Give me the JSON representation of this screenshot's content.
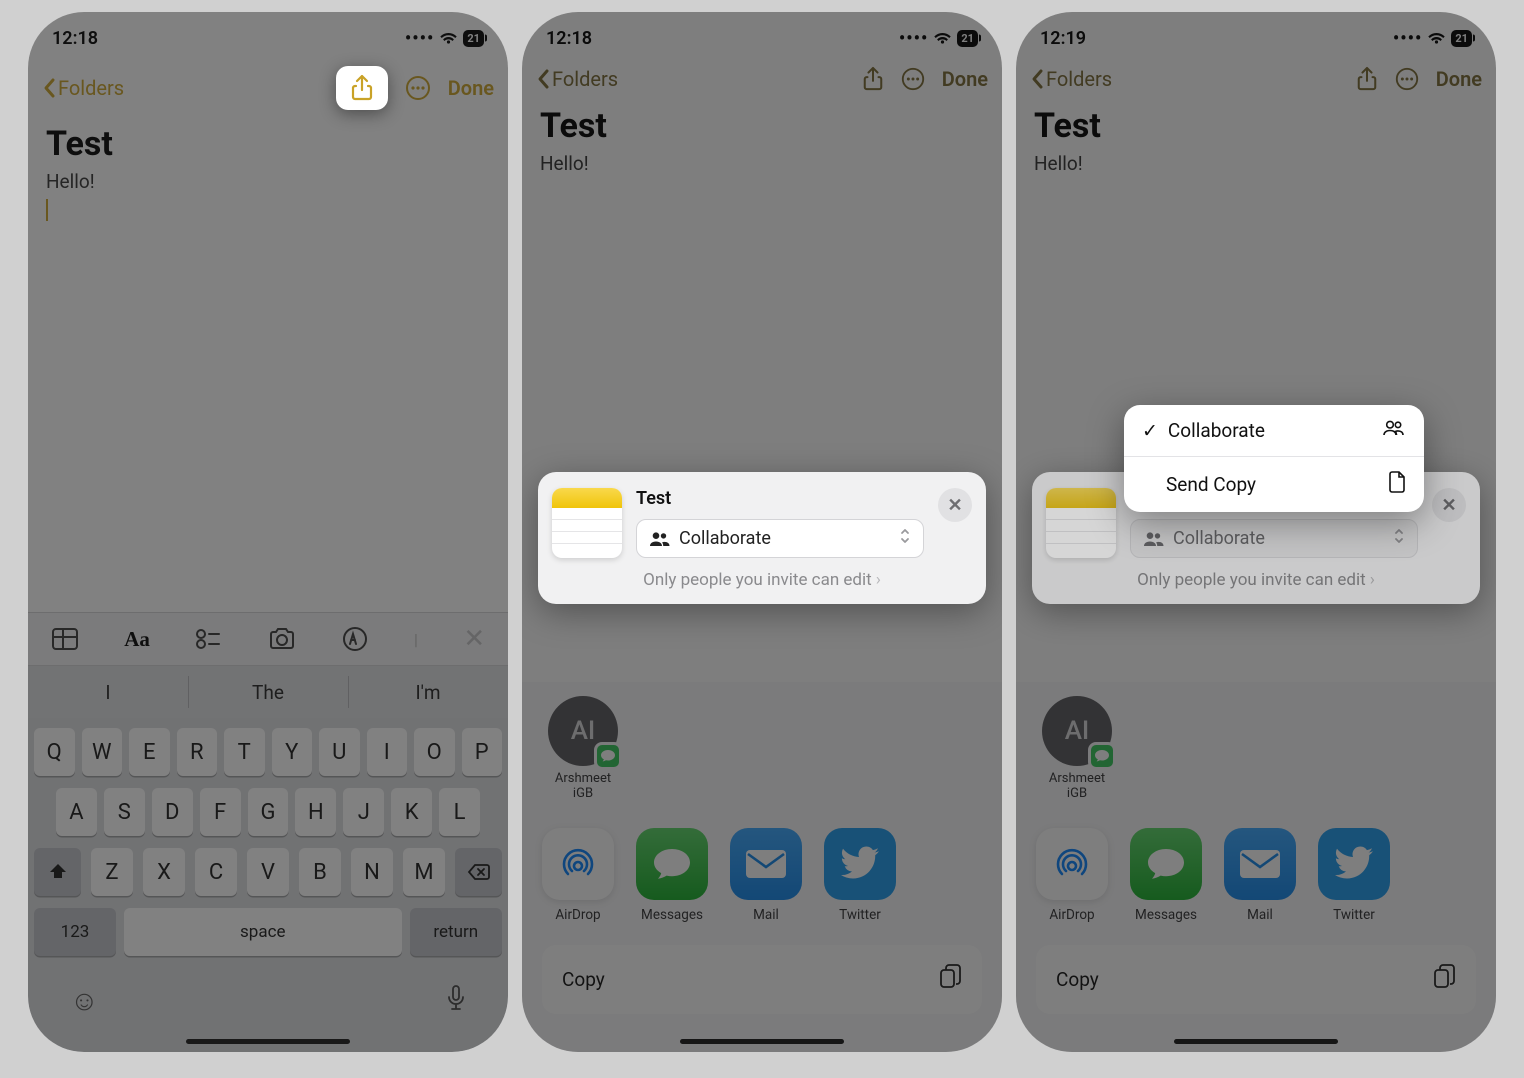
{
  "status": {
    "time1": "12:18",
    "time2": "12:18",
    "time3": "12:19",
    "battery": "21"
  },
  "nav": {
    "back": "Folders",
    "done": "Done"
  },
  "note": {
    "title": "Test",
    "body": "Hello!"
  },
  "keyboard": {
    "sugg1": "I",
    "sugg2": "The",
    "sugg3": "I'm",
    "k123": "123",
    "space": "space",
    "ret": "return"
  },
  "share": {
    "title": "Test",
    "collab": "Collaborate",
    "perm": "Only people you invite can edit"
  },
  "popup": {
    "collaborate": "Collaborate",
    "send_copy": "Send Copy"
  },
  "contact": {
    "initials": "AI",
    "name": "Arshmeet\niGB"
  },
  "apps": {
    "airdrop": "AirDrop",
    "messages": "Messages",
    "mail": "Mail",
    "twitter": "Twitter"
  },
  "actions": {
    "copy": "Copy"
  }
}
